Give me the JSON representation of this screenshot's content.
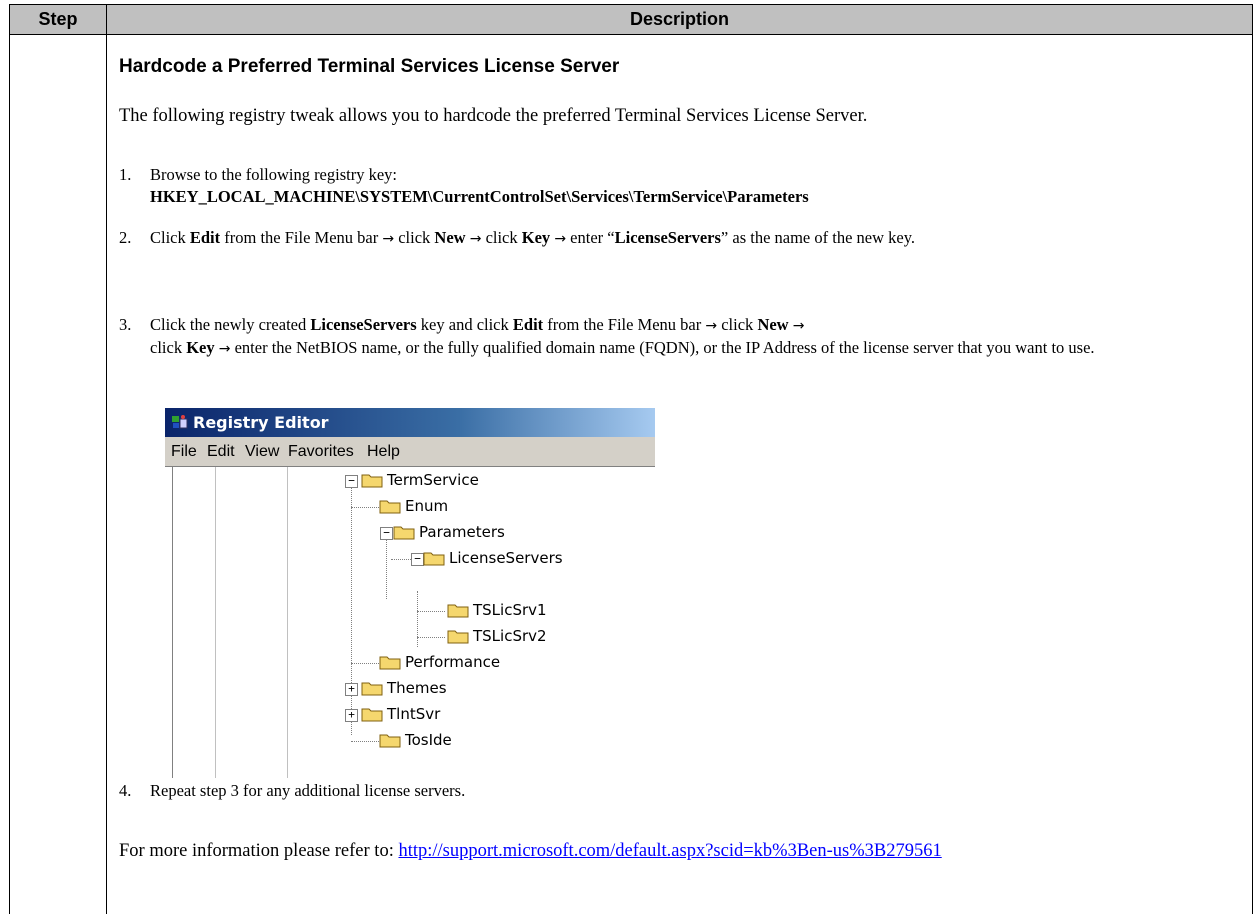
{
  "table": {
    "col_step": "Step",
    "col_description": "Description"
  },
  "content": {
    "title": "Hardcode a Preferred Terminal Services License Server",
    "intro": "The following registry tweak allows you to hardcode the preferred Terminal Services License Server.",
    "steps": [
      {
        "num": "1.",
        "text": "Browse to the following registry key:",
        "key": "HKEY_LOCAL_MACHINE\\SYSTEM\\CurrentControlSet\\Services\\TermService\\Parameters"
      },
      {
        "num": "2.",
        "p1": "Click ",
        "b1": "Edit",
        "p2": " from the File Menu bar ",
        "p3": " click ",
        "b2": "New",
        "p4": " click ",
        "b3": "Key",
        "p5": " enter “",
        "b4": "LicenseServers",
        "p6": "” as the name of the new key."
      },
      {
        "num": "3.",
        "p1": "Click the newly created ",
        "b1": "LicenseServers",
        "p2": " key and click ",
        "b2": "Edit",
        "p3": " from the File Menu bar ",
        "p4": " click ",
        "b3": "New",
        "p5": "click ",
        "b4": "Key",
        "p6": " enter the NetBIOS name, or the fully qualified domain name (FQDN), or the IP Address of the license server that you want to use."
      },
      {
        "num": "4.",
        "text": "Repeat step 3 for any additional license servers."
      }
    ],
    "arrow": "→",
    "more_prefix": "For more information please refer to: ",
    "more_link": "http://support.microsoft.com/default.aspx?scid=kb%3Ben-us%3B279561"
  },
  "registry_editor": {
    "title": "Registry Editor",
    "menu": [
      "File",
      "Edit",
      "View",
      "Favorites",
      "Help"
    ],
    "tree": [
      "TermService",
      "Enum",
      "Parameters",
      "LicenseServers",
      "TSLicSrv1",
      "TSLicSrv2",
      "Performance",
      "Themes",
      "TlntSvr",
      "TosIde"
    ],
    "expand_minus": "−",
    "expand_plus": "+",
    "colors": {
      "title_start": "#0a246a",
      "title_end": "#a6caf0",
      "menu_bg": "#d4d0c8",
      "folder": "#f5d76e"
    }
  }
}
